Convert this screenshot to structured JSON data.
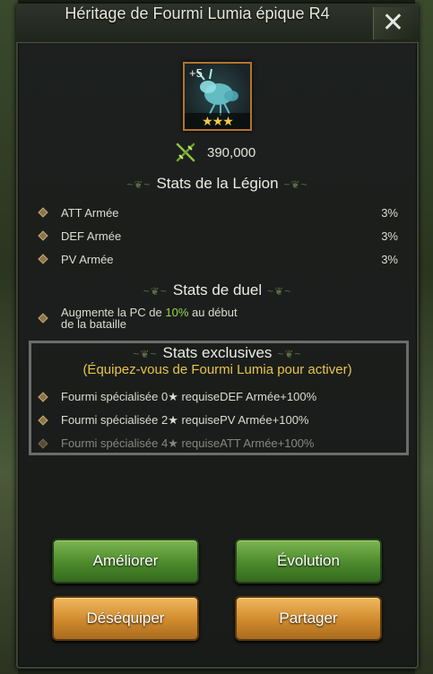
{
  "title": "Héritage de Fourmi Lumia épique R4",
  "colors": {
    "accent_green": "#9ad34a",
    "accent_gold": "#e6c54a",
    "button_green": "#4c8a2c",
    "button_orange": "#d08a2d"
  },
  "item": {
    "level": "+5",
    "stars": "★★★",
    "icon": "ant-creature-icon"
  },
  "power": {
    "value": "390,000",
    "icon": "crossed-swords-icon"
  },
  "legion": {
    "heading": "Stats de la Légion",
    "stats": [
      {
        "label": "ATT Armée",
        "value": "3%"
      },
      {
        "label": "DEF Armée",
        "value": "3%"
      },
      {
        "label": "PV Armée",
        "value": "3%"
      }
    ]
  },
  "duel": {
    "heading": "Stats de duel",
    "text_before": "Augmente la PC de ",
    "highlight": "10%",
    "text_after": " au début de la bataille"
  },
  "exclusive": {
    "heading": "Stats exclusives",
    "subtitle": "(Équipez-vous de Fourmi Lumia pour activer)",
    "stats": [
      {
        "label": "Fourmi spécialisée 0★ requiseDEF Armée+100%"
      },
      {
        "label": "Fourmi spécialisée 2★ requisePV Armée+100%"
      },
      {
        "label": "Fourmi spécialisée 4★ requiseATT Armée+100%"
      }
    ]
  },
  "buttons": {
    "upgrade": "Améliorer",
    "evolution": "Évolution",
    "unequip": "Déséquiper",
    "share": "Partager"
  },
  "close_symbol": "✕"
}
